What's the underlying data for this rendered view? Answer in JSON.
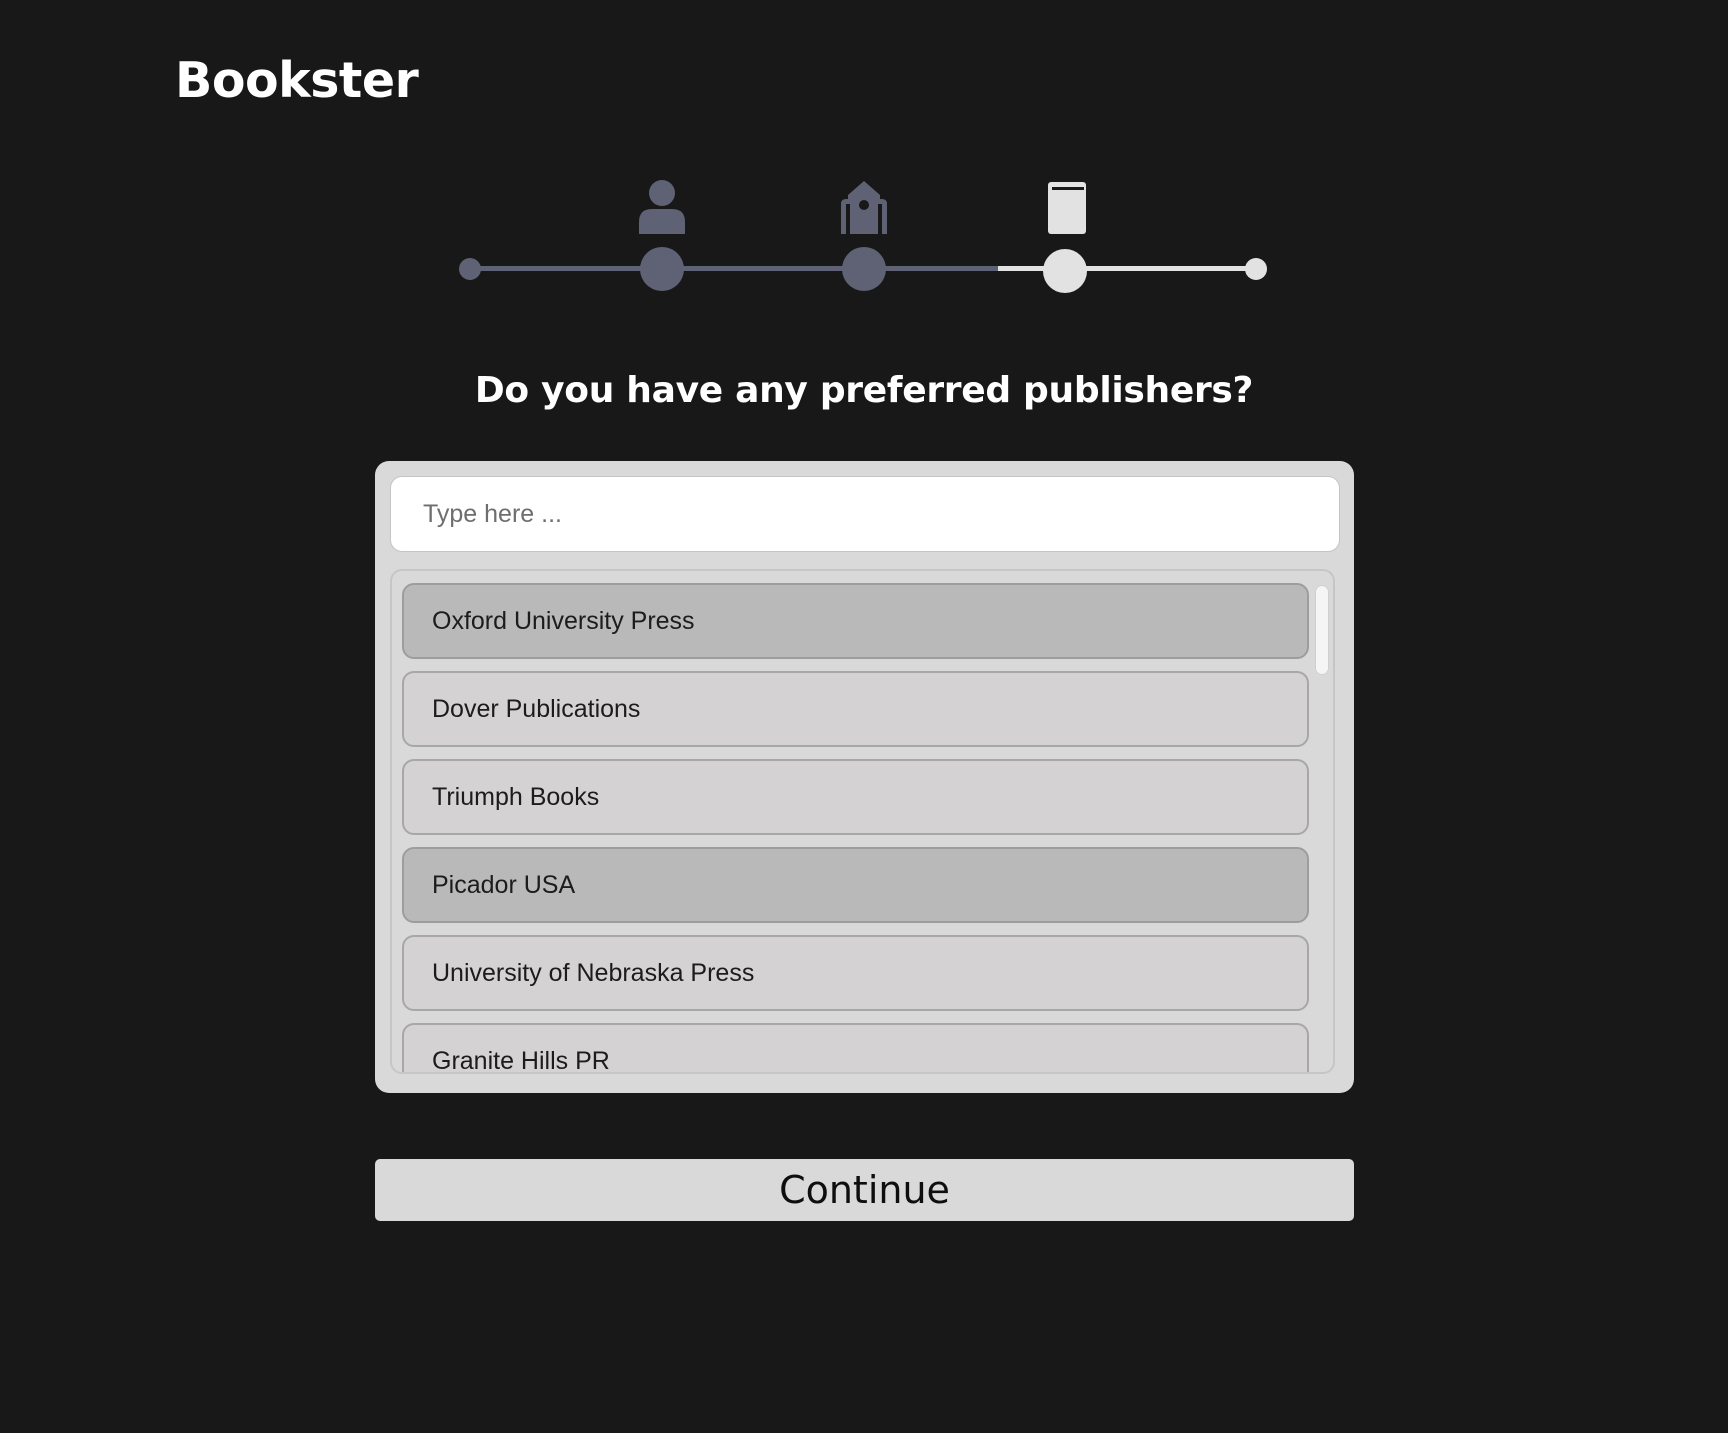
{
  "app": {
    "logo": "Bookster"
  },
  "stepper": {
    "steps": [
      {
        "icon": "person-icon",
        "status": "completed"
      },
      {
        "icon": "building-icon",
        "status": "completed"
      },
      {
        "icon": "book-icon",
        "status": "current"
      }
    ],
    "colors": {
      "completed": "#5e6274",
      "upcoming": "#d9d9d9"
    }
  },
  "question": {
    "title": "Do you have any preferred publishers?"
  },
  "search": {
    "placeholder": "Type here ...",
    "value": ""
  },
  "publishers": {
    "items": [
      {
        "label": "Oxford University Press",
        "selected": true
      },
      {
        "label": "Dover Publications",
        "selected": false
      },
      {
        "label": "Triumph Books",
        "selected": false
      },
      {
        "label": "Picador USA",
        "selected": true
      },
      {
        "label": "University of Nebraska Press",
        "selected": false
      },
      {
        "label": "Granite Hills PR",
        "selected": false
      }
    ]
  },
  "actions": {
    "continue_label": "Continue"
  }
}
